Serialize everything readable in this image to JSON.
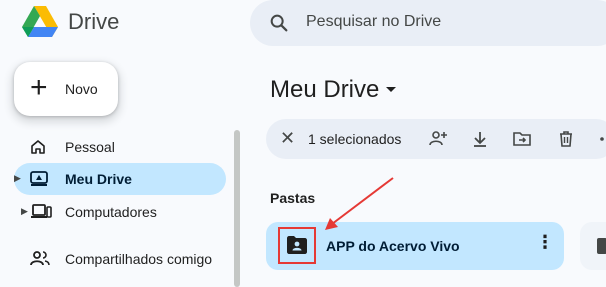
{
  "app": {
    "name": "Drive"
  },
  "search": {
    "placeholder": "Pesquisar no Drive"
  },
  "new_button": {
    "label": "Novo"
  },
  "sidebar": {
    "items": [
      {
        "label": "Pessoal",
        "icon": "home-icon"
      },
      {
        "label": "Meu Drive",
        "icon": "drive-icon",
        "active": true
      },
      {
        "label": "Computadores",
        "icon": "computer-icon"
      },
      {
        "label": "Compartilhados comigo",
        "icon": "shared-icon"
      }
    ]
  },
  "main": {
    "title": "Meu Drive",
    "selection": {
      "count_label": "1 selecionados",
      "actions": [
        "share-user-icon",
        "download-icon",
        "move-icon",
        "trash-icon"
      ]
    },
    "section": "Pastas",
    "folders": [
      {
        "name": "APP do Acervo Vivo",
        "icon": "shared-folder-icon",
        "selected": true
      }
    ]
  },
  "colors": {
    "selected": "#c2e7ff",
    "searchbar": "#e9eef6",
    "annotation": "#e53935"
  }
}
